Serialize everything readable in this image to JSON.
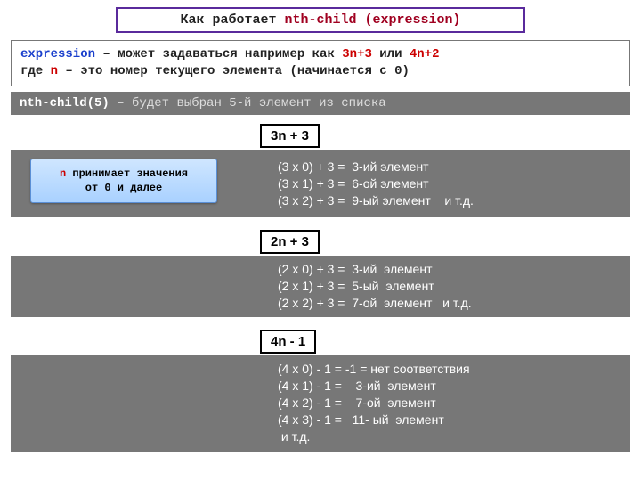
{
  "title": {
    "prefix": "Как работает  ",
    "selector": "nth-child (expression)"
  },
  "expr": {
    "word_expression": "expression",
    "seg1": " – может задаваться например как  ",
    "ex1": "3n+3",
    "seg2": " или  ",
    "ex2": "4n+2",
    "line2a": "  где ",
    "n": "n",
    "line2b": " – это номер текущего элемента (начинается с  0)"
  },
  "bar5": {
    "sel": "nth-child(5)",
    "rest": " – будет выбран 5-й элемент из списка"
  },
  "note": {
    "n": "n",
    "rest1": " принимает значения",
    "rest2": "от 0 и далее"
  },
  "s1": {
    "label": "3n + 3",
    "l1": "(3 x 0) + 3 =  3-ий элемент",
    "l2": "(3 x 1) + 3 =  6-ой элемент",
    "l3": "(3 x 2) + 3 =  9-ый элемент    и т.д."
  },
  "s2": {
    "label": "2n + 3",
    "l1": "(2 x 0) + 3 =  3-ий  элемент",
    "l2": "(2 x 1) + 3 =  5-ый  элемент",
    "l3": "(2 x 2) + 3 =  7-ой  элемент   и т.д."
  },
  "s3": {
    "label": "4n - 1",
    "l1": "(4 x 0) - 1 = -1 = нет соответствия",
    "l2": "(4 x 1) - 1 =    3-ий  элемент",
    "l3": "(4 x 2) - 1 =    7-ой  элемент",
    "l4": "(4 x 3) - 1 =   11- ый  элемент",
    "l5": " и т.д."
  }
}
